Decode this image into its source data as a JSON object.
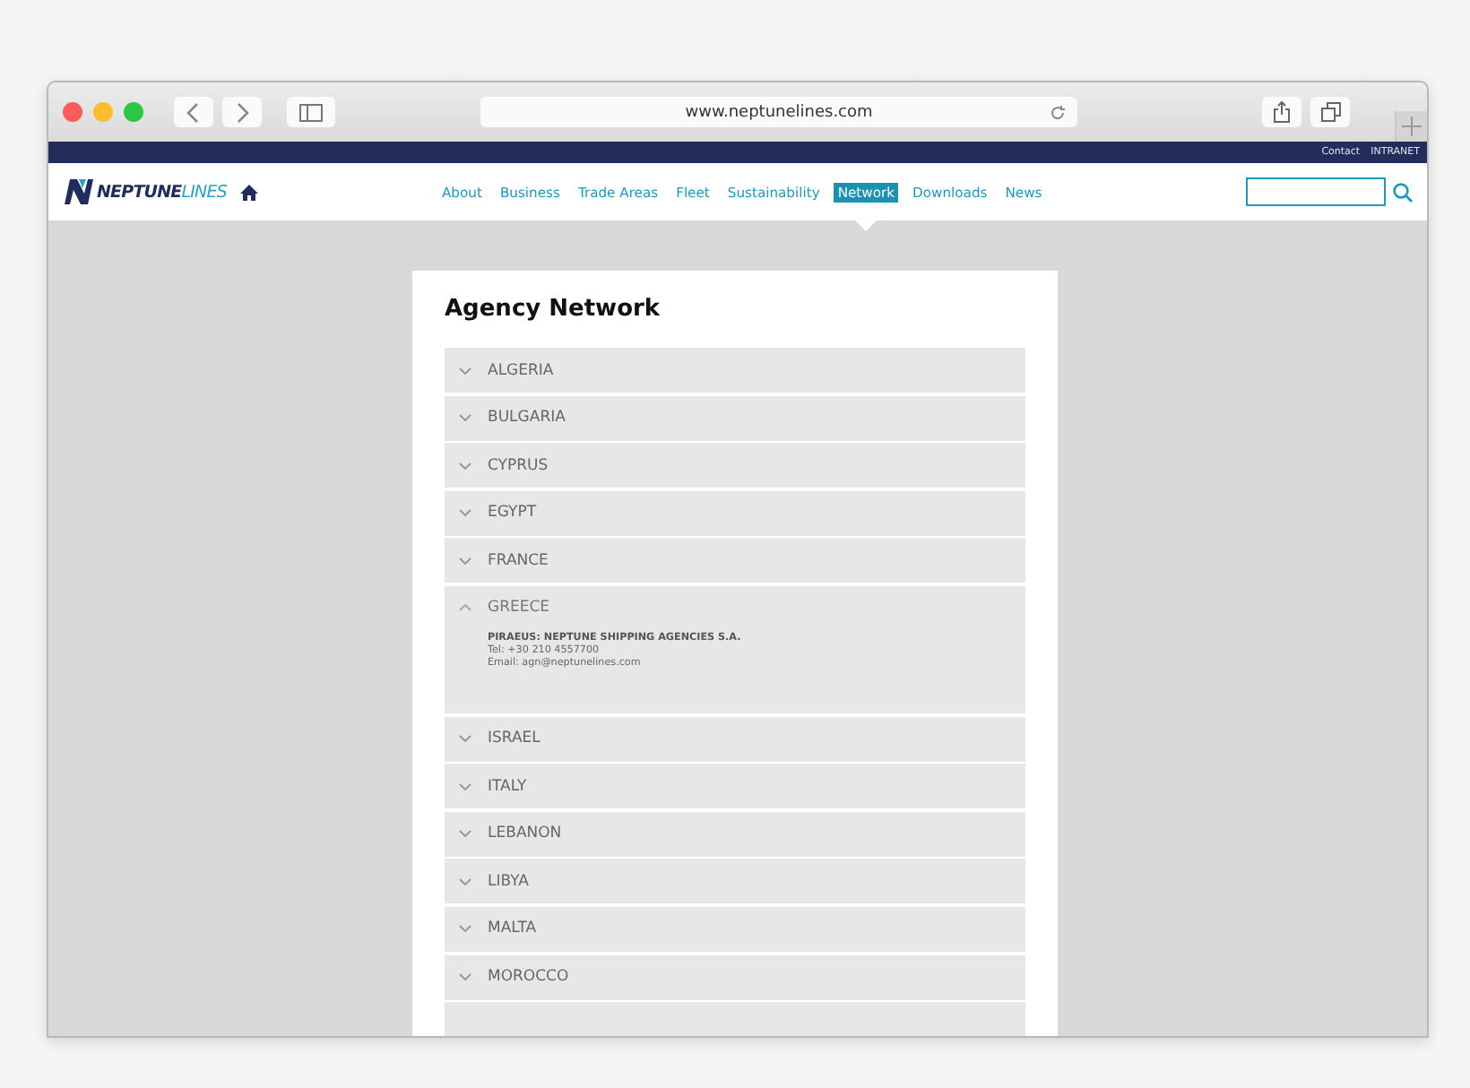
{
  "browser": {
    "url": "www.neptunelines.com"
  },
  "top_bar": {
    "links": [
      "Contact",
      "INTRANET"
    ]
  },
  "header": {
    "logo": {
      "bold": "NEPTUNE",
      "light": "LINES"
    },
    "nav": [
      {
        "label": "About",
        "selected": false
      },
      {
        "label": "Business",
        "selected": false
      },
      {
        "label": "Trade Areas",
        "selected": false
      },
      {
        "label": "Fleet",
        "selected": false
      },
      {
        "label": "Sustainability",
        "selected": false
      },
      {
        "label": "Network",
        "selected": true
      },
      {
        "label": "Downloads",
        "selected": false
      },
      {
        "label": "News",
        "selected": false
      }
    ]
  },
  "page": {
    "title": "Agency Network",
    "countries": [
      {
        "name": "ALGERIA",
        "expanded": false
      },
      {
        "name": "BULGARIA",
        "expanded": false
      },
      {
        "name": "CYPRUS",
        "expanded": false
      },
      {
        "name": "EGYPT",
        "expanded": false
      },
      {
        "name": "FRANCE",
        "expanded": false
      },
      {
        "name": "GREECE",
        "expanded": true,
        "agency": "PIRAEUS: NEPTUNE SHIPPING AGENCIES S.A.",
        "phone": "Tel: +30 210 4557700",
        "email": "Email: agn@neptunelines.com"
      },
      {
        "name": "ISRAEL",
        "expanded": false
      },
      {
        "name": "ITALY",
        "expanded": false
      },
      {
        "name": "LEBANON",
        "expanded": false
      },
      {
        "name": "LIBYA",
        "expanded": false
      },
      {
        "name": "MALTA",
        "expanded": false
      },
      {
        "name": "MOROCCO",
        "expanded": false
      }
    ]
  }
}
